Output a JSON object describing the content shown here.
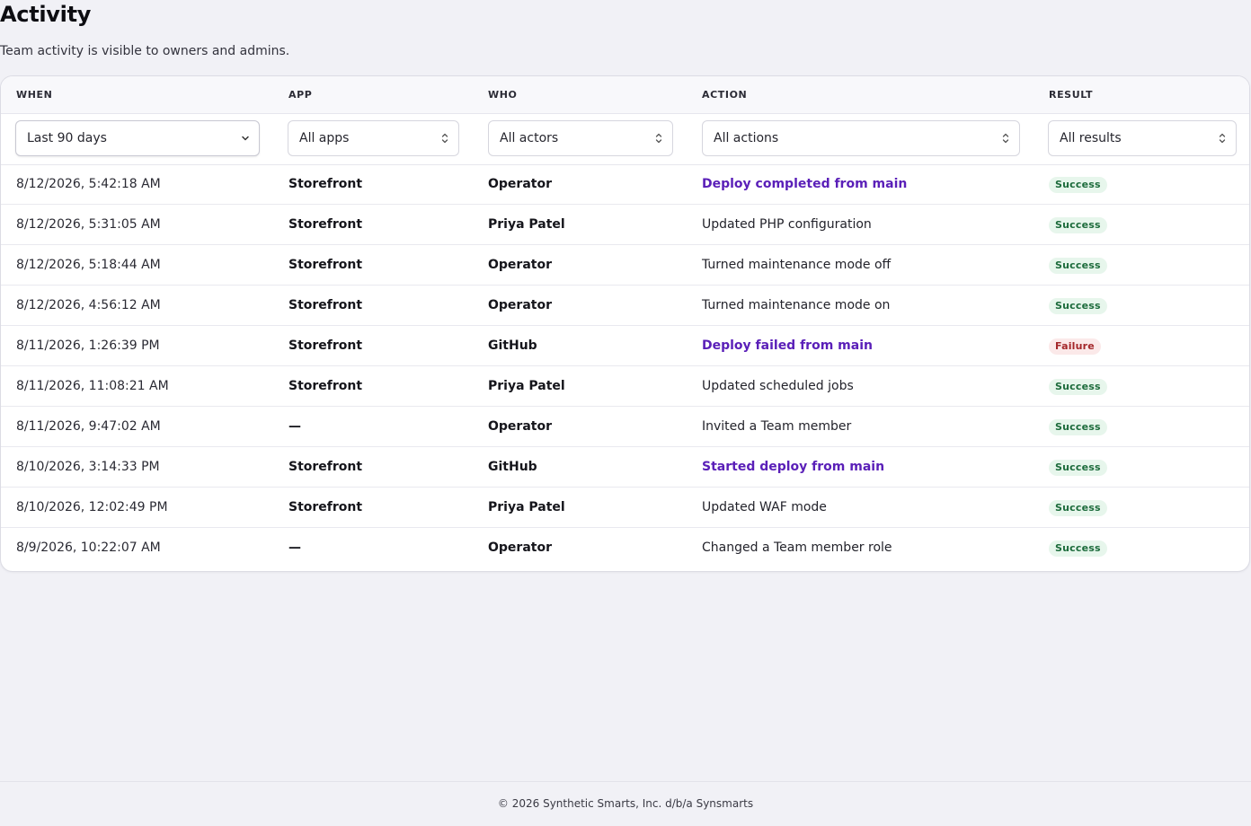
{
  "page": {
    "title": "Activity",
    "subtitle": "Team activity is visible to owners and admins."
  },
  "table": {
    "headers": {
      "when": "WHEN",
      "app": "APP",
      "who": "WHO",
      "action": "ACTION",
      "result": "RESULT"
    },
    "filters": {
      "when": "Last 90 days",
      "app": "All apps",
      "who": "All actors",
      "action": "All actions",
      "result": "All results"
    },
    "rows": [
      {
        "when": "8/12/2026, 5:42:18 AM",
        "app": "Storefront",
        "who": "Operator",
        "action": "Deploy completed from main",
        "action_link": true,
        "result": "Success"
      },
      {
        "when": "8/12/2026, 5:31:05 AM",
        "app": "Storefront",
        "who": "Priya Patel",
        "action": "Updated PHP configuration",
        "action_link": false,
        "result": "Success"
      },
      {
        "when": "8/12/2026, 5:18:44 AM",
        "app": "Storefront",
        "who": "Operator",
        "action": "Turned maintenance mode off",
        "action_link": false,
        "result": "Success"
      },
      {
        "when": "8/12/2026, 4:56:12 AM",
        "app": "Storefront",
        "who": "Operator",
        "action": "Turned maintenance mode on",
        "action_link": false,
        "result": "Success"
      },
      {
        "when": "8/11/2026, 1:26:39 PM",
        "app": "Storefront",
        "who": "GitHub",
        "action": "Deploy failed from main",
        "action_link": true,
        "result": "Failure"
      },
      {
        "when": "8/11/2026, 11:08:21 AM",
        "app": "Storefront",
        "who": "Priya Patel",
        "action": "Updated scheduled jobs",
        "action_link": false,
        "result": "Success"
      },
      {
        "when": "8/11/2026, 9:47:02 AM",
        "app": "—",
        "who": "Operator",
        "action": "Invited a Team member",
        "action_link": false,
        "result": "Success"
      },
      {
        "when": "8/10/2026, 3:14:33 PM",
        "app": "Storefront",
        "who": "GitHub",
        "action": "Started deploy from main",
        "action_link": true,
        "result": "Success"
      },
      {
        "when": "8/10/2026, 12:02:49 PM",
        "app": "Storefront",
        "who": "Priya Patel",
        "action": "Updated WAF mode",
        "action_link": false,
        "result": "Success"
      },
      {
        "when": "8/9/2026, 10:22:07 AM",
        "app": "—",
        "who": "Operator",
        "action": "Changed a Team member role",
        "action_link": false,
        "result": "Success"
      }
    ]
  },
  "colors": {
    "link": "#5a1fb8",
    "success_bg": "#e7f6ec",
    "success_fg": "#1c6b3b",
    "failure_bg": "#fbe9e9",
    "failure_fg": "#a4272a"
  },
  "icons": {
    "when_select": "chevron-down-icon",
    "other_selects": "chevron-up-down-icon"
  },
  "footer": {
    "text": "© 2026 Synthetic Smarts, Inc. d/b/a Synsmarts"
  }
}
